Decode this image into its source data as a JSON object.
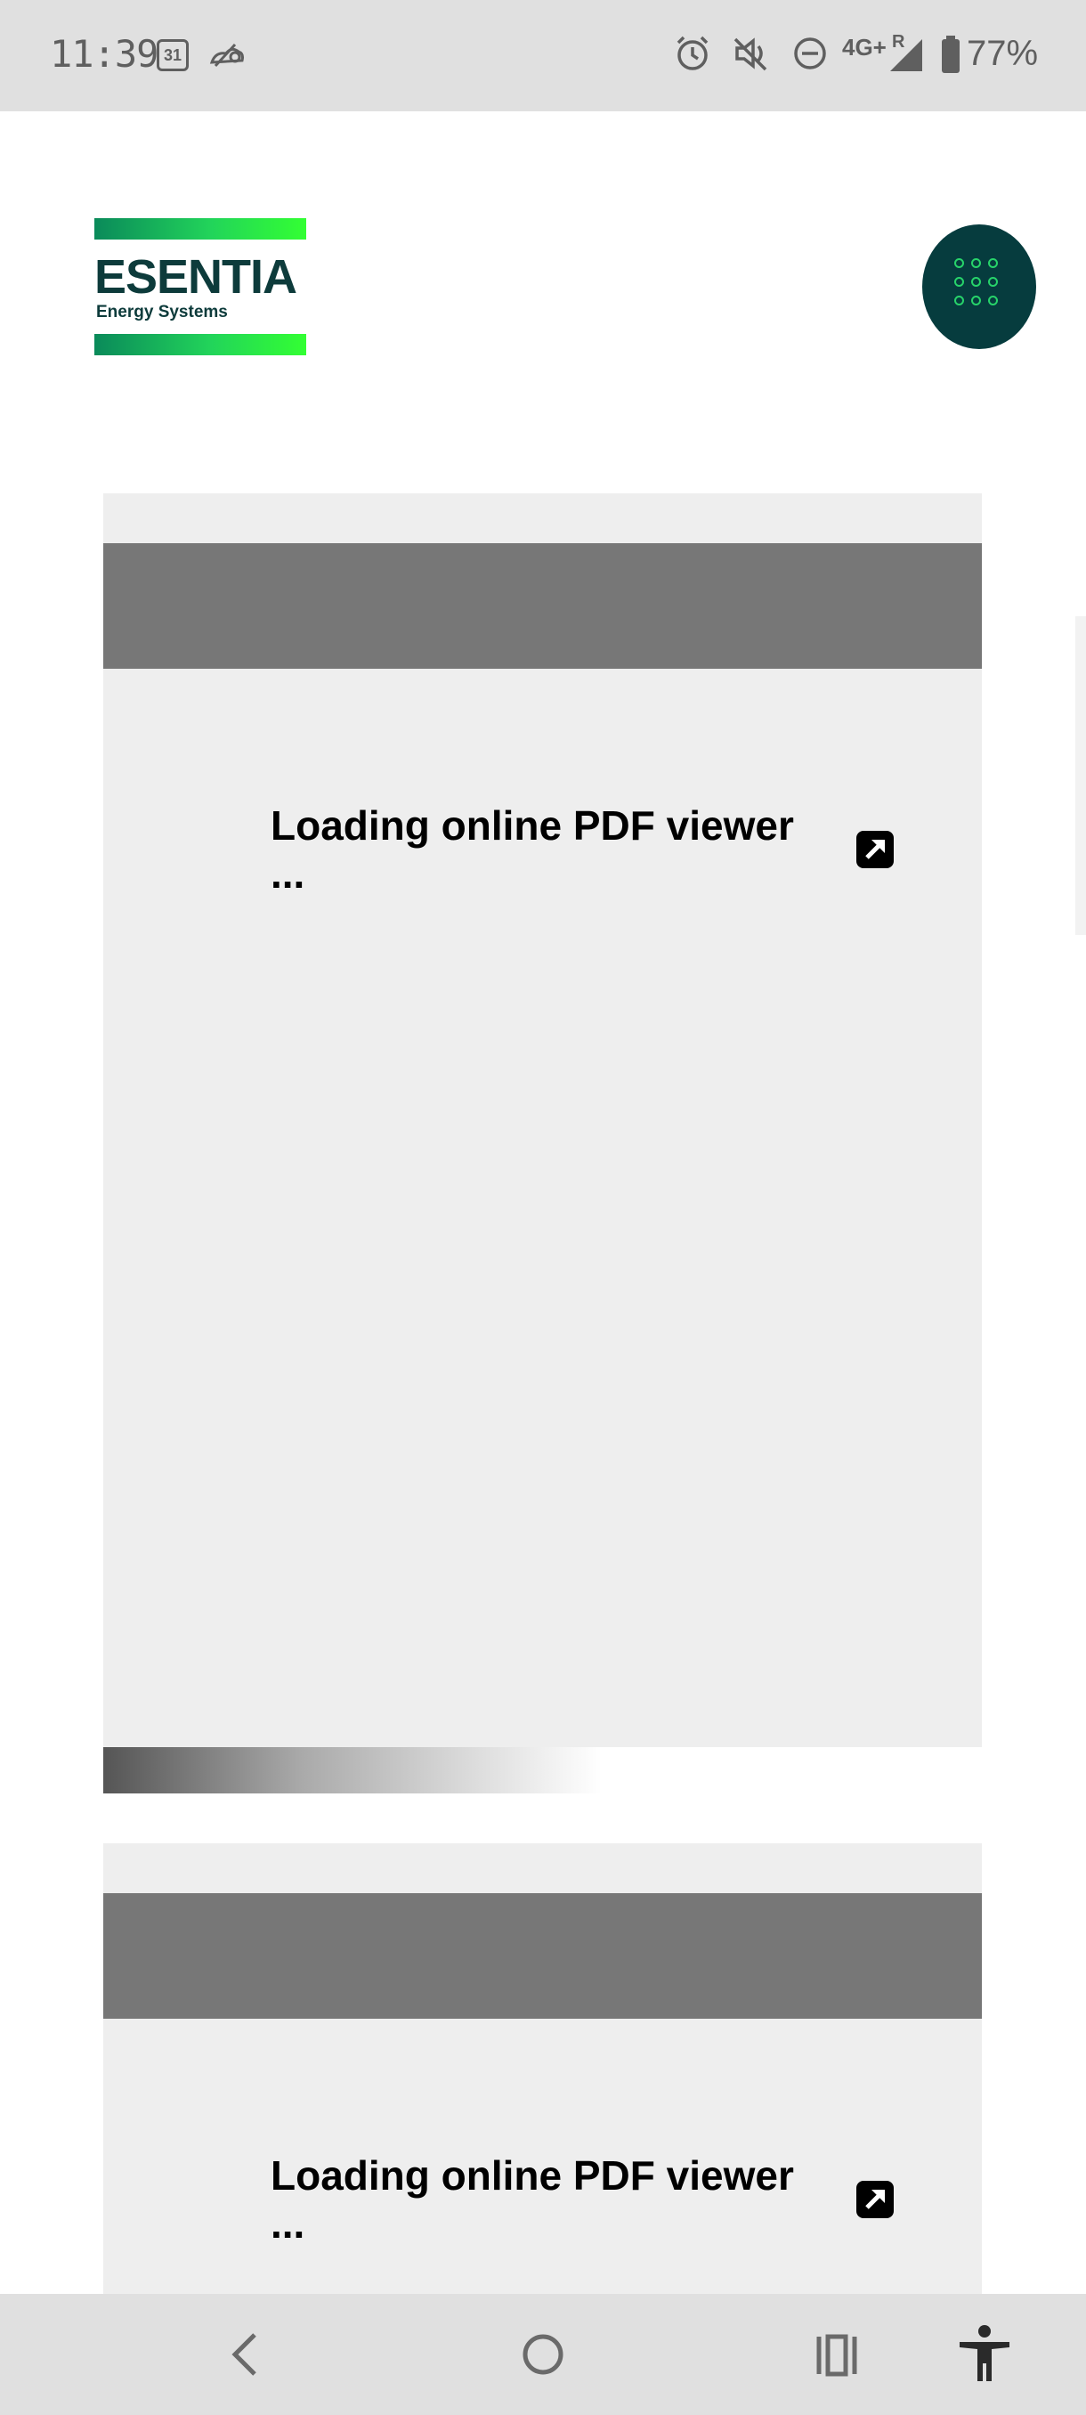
{
  "status_bar": {
    "time": "11:39",
    "calendar_day": "31",
    "network": "4G+",
    "roaming": "R",
    "battery": "77%"
  },
  "header": {
    "logo_word": "ESENTIA",
    "logo_sub": "Energy Systems",
    "menu_icon": "grid-dots-icon"
  },
  "viewers": [
    {
      "loading_text": "Loading online PDF viewer ...",
      "icon": "external-link-icon"
    },
    {
      "loading_text": "Loading online PDF viewer ...",
      "icon": "external-link-icon"
    }
  ],
  "nav_bar": {
    "back": "back-icon",
    "home": "home-icon",
    "recents": "recents-icon",
    "accessibility": "accessibility-icon"
  },
  "colors": {
    "brand_dark": "#063c3e",
    "brand_green": "#33ff33",
    "card_bg": "#eeeeee",
    "toolbar_bg": "#777777"
  }
}
